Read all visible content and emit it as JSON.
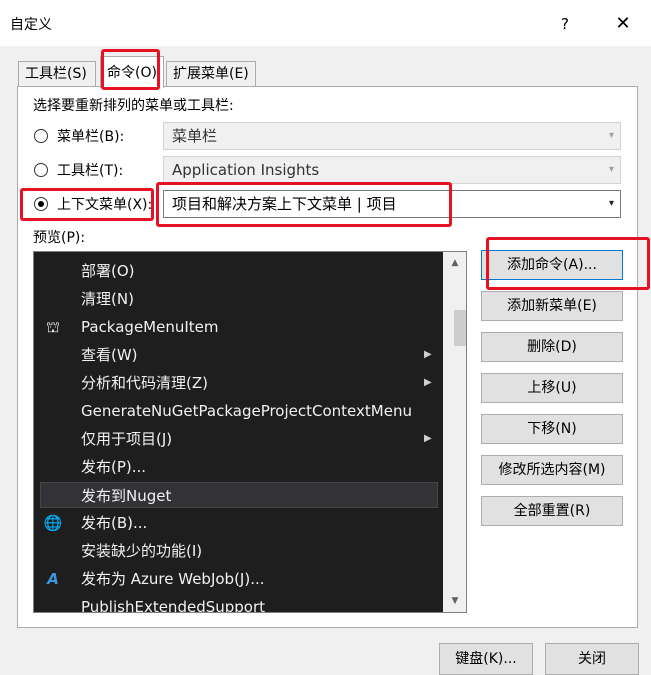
{
  "window": {
    "title": "自定义",
    "help_glyph": "?",
    "close_glyph": "✕"
  },
  "tabs": [
    {
      "label": "工具栏(S)",
      "active": false
    },
    {
      "label": "命令(O)",
      "active": true
    },
    {
      "label": "扩展菜单(E)",
      "active": false
    }
  ],
  "section_label": "选择要重新排列的菜单或工具栏:",
  "options": {
    "menubar": {
      "label": "菜单栏(B):",
      "value": "菜单栏",
      "checked": false
    },
    "toolbar": {
      "label": "工具栏(T):",
      "value": "Application Insights",
      "checked": false
    },
    "context_menu": {
      "label": "上下文菜单(X):",
      "value": "项目和解决方案上下文菜单 | 项目",
      "checked": true
    }
  },
  "preview_label": "预览(P):",
  "preview_items": [
    {
      "text": "部署(O)",
      "icon": "",
      "submenu": false,
      "selected": false
    },
    {
      "text": "清理(N)",
      "icon": "",
      "submenu": false,
      "selected": false
    },
    {
      "text": "PackageMenuItem",
      "icon": "package-icon",
      "submenu": false,
      "selected": false
    },
    {
      "text": "查看(W)",
      "icon": "",
      "submenu": true,
      "selected": false
    },
    {
      "text": "分析和代码清理(Z)",
      "icon": "",
      "submenu": true,
      "selected": false
    },
    {
      "text": "GenerateNuGetPackageProjectContextMenu",
      "icon": "",
      "submenu": false,
      "selected": false
    },
    {
      "text": "仅用于项目(J)",
      "icon": "",
      "submenu": true,
      "selected": false
    },
    {
      "text": "发布(P)...",
      "icon": "",
      "submenu": false,
      "selected": false
    },
    {
      "text": "发布到Nuget",
      "icon": "",
      "submenu": false,
      "selected": true
    },
    {
      "text": "发布(B)...",
      "icon": "globe-publish-icon",
      "submenu": false,
      "selected": false
    },
    {
      "text": "安装缺少的功能(I)",
      "icon": "",
      "submenu": false,
      "selected": false
    },
    {
      "text": "发布为 Azure WebJob(J)...",
      "icon": "azure-icon",
      "submenu": false,
      "selected": false
    },
    {
      "text": "PublishExtendedSupport",
      "icon": "",
      "submenu": false,
      "selected": false
    }
  ],
  "side_buttons": {
    "add_command": "添加命令(A)...",
    "add_menu": "添加新菜单(E)",
    "delete": "删除(D)",
    "move_up": "上移(U)",
    "move_down": "下移(N)",
    "modify": "修改所选内容(M)",
    "reset_all": "全部重置(R)"
  },
  "bottom_buttons": {
    "keyboard": "键盘(K)...",
    "close": "关闭"
  },
  "glyphs": {
    "submenu_arrow": "▶",
    "dropdown_arrow": "▾",
    "scroll_up": "▲",
    "scroll_down": "▼",
    "package": "⛫",
    "globe": "🌐",
    "azure": "A"
  },
  "colors": {
    "highlight": "#e81123",
    "preview_bg": "#1e1e1e",
    "accent": "#0078d7",
    "azure": "#3a96dd"
  }
}
